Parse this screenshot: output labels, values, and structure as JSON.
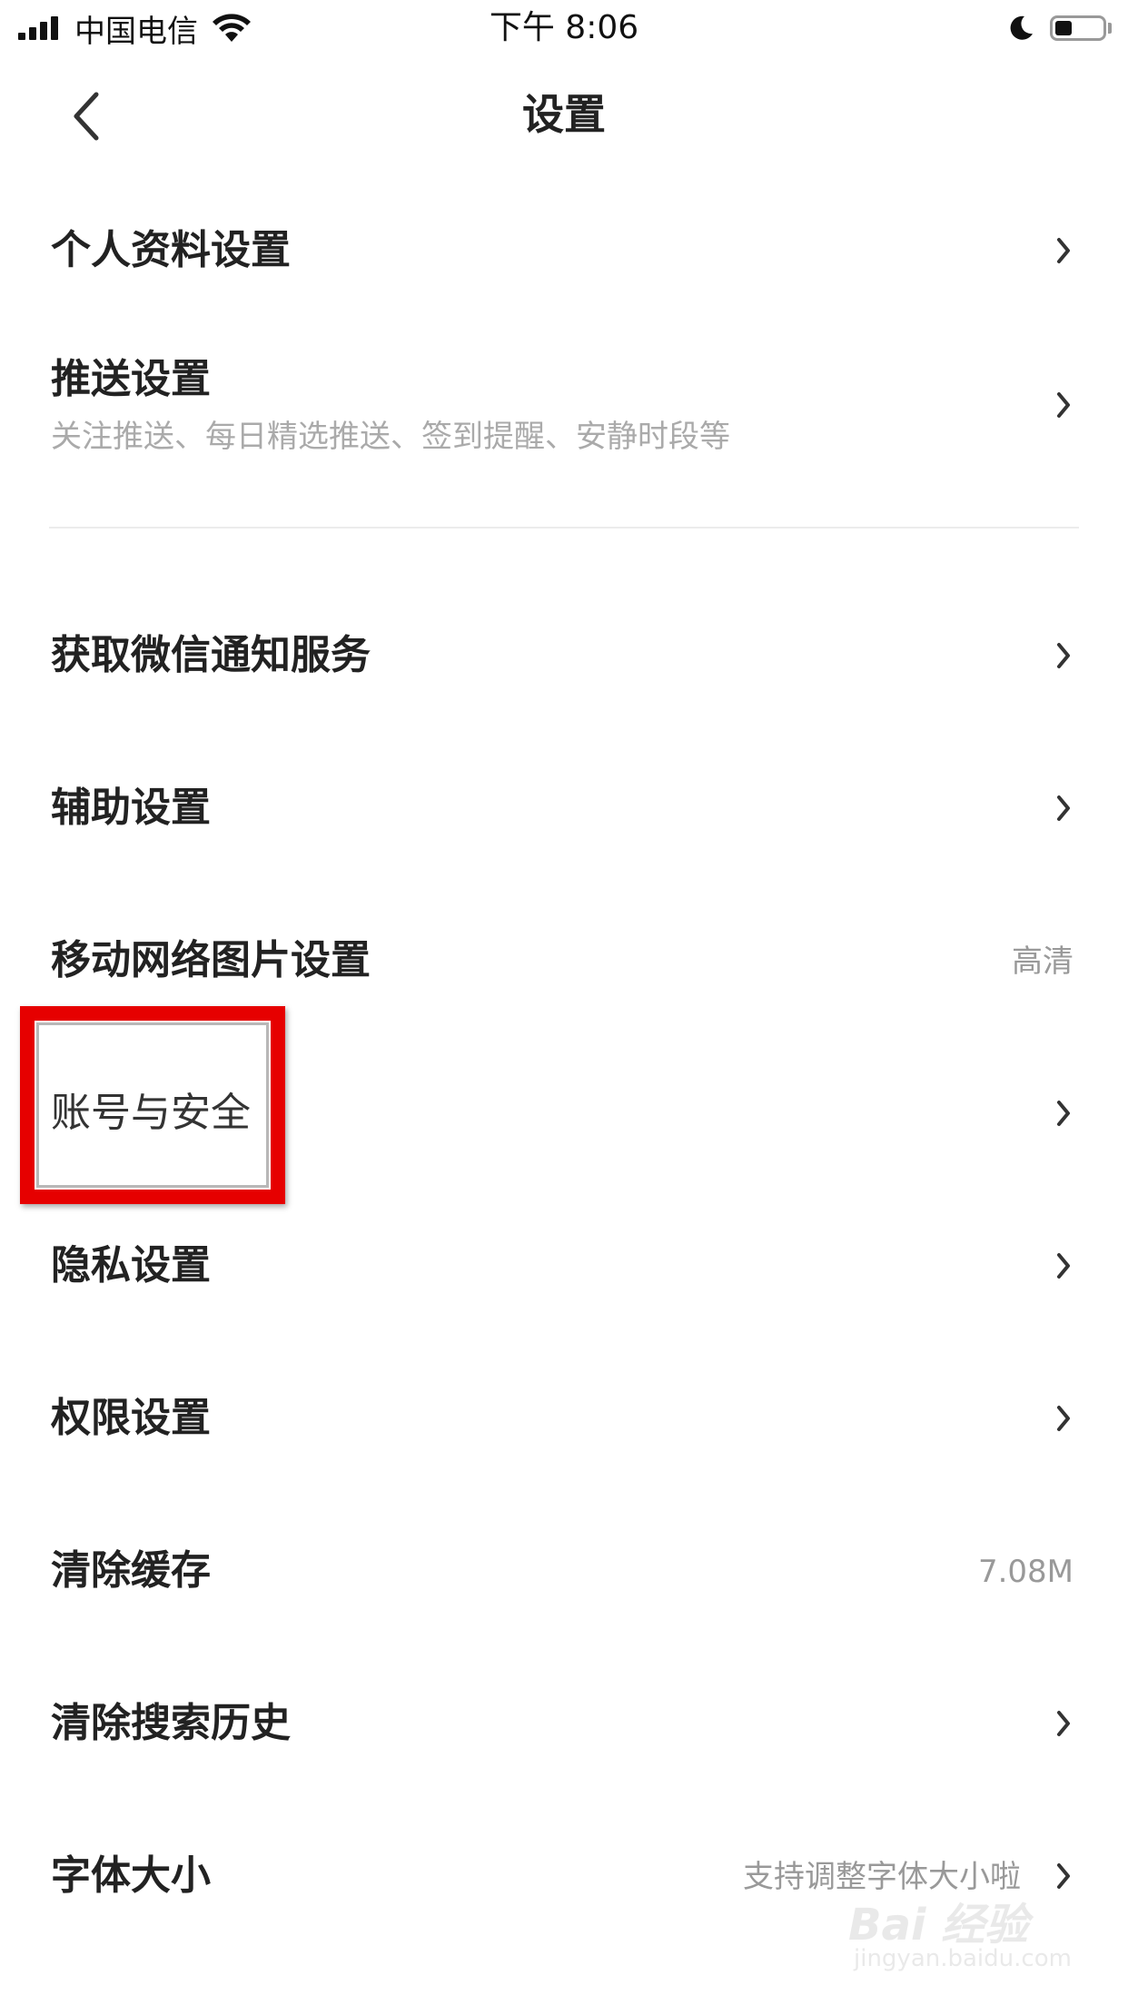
{
  "status_bar": {
    "carrier": "中国电信",
    "time": "下午 8:06",
    "battery_level": 0.35,
    "icons": [
      "signal-icon",
      "wifi-icon",
      "moon-icon",
      "battery-icon"
    ]
  },
  "nav": {
    "title": "设置",
    "back_icon": "chevron-left-icon"
  },
  "settings": {
    "profile": {
      "label": "个人资料设置"
    },
    "push": {
      "label": "推送设置",
      "subtitle": "关注推送、每日精选推送、签到提醒、安静时段等"
    },
    "wechat_notify": {
      "label": "获取微信通知服务"
    },
    "accessibility": {
      "label": "辅助设置"
    },
    "mobile_images": {
      "label": "移动网络图片设置",
      "value": "高清"
    },
    "account_security": {
      "label": "账号与安全"
    },
    "privacy": {
      "label": "隐私设置"
    },
    "permissions": {
      "label": "权限设置"
    },
    "clear_cache": {
      "label": "清除缓存",
      "value": "7.08M"
    },
    "clear_search": {
      "label": "清除搜索历史"
    },
    "font_size": {
      "label": "字体大小",
      "value": "支持调整字体大小啦"
    }
  },
  "highlight": {
    "color": "#e60000",
    "target": "account_security"
  },
  "watermark": {
    "text": "Bai 经验",
    "sub": "jingyan.baidu.com"
  },
  "colors": {
    "text_primary": "#222222",
    "text_secondary": "#aaaaaa",
    "value_text": "#999999",
    "divider": "#ececec",
    "highlight": "#e60000"
  }
}
